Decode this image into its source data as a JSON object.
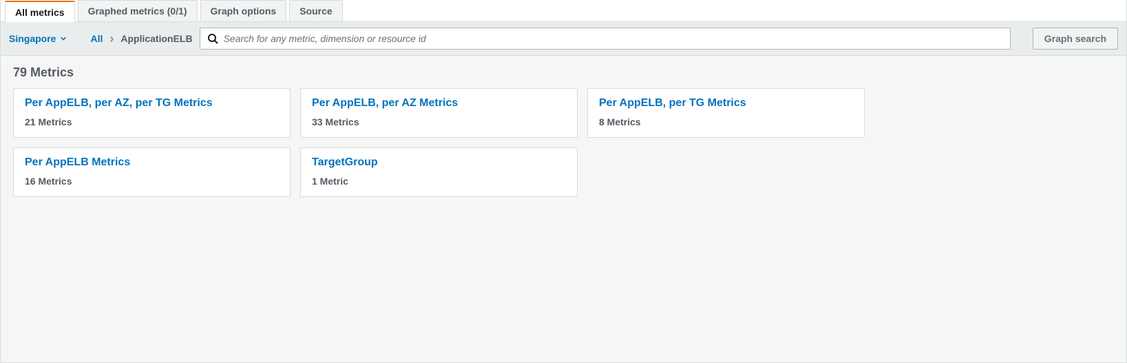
{
  "tabs": {
    "all_metrics": "All metrics",
    "graphed_metrics": "Graphed metrics (0/1)",
    "graph_options": "Graph options",
    "source": "Source"
  },
  "toolbar": {
    "region": "Singapore",
    "breadcrumb_all": "All",
    "breadcrumb_current": "ApplicationELB",
    "search_placeholder": "Search for any metric, dimension or resource id",
    "graph_search_label": "Graph search"
  },
  "content": {
    "heading": "79 Metrics",
    "cards": [
      {
        "title": "Per AppELB, per AZ, per TG Metrics",
        "subtitle": "21 Metrics"
      },
      {
        "title": "Per AppELB, per AZ Metrics",
        "subtitle": "33 Metrics"
      },
      {
        "title": "Per AppELB, per TG Metrics",
        "subtitle": "8 Metrics"
      },
      {
        "title": "Per AppELB Metrics",
        "subtitle": "16 Metrics"
      },
      {
        "title": "TargetGroup",
        "subtitle": "1 Metric"
      }
    ]
  }
}
